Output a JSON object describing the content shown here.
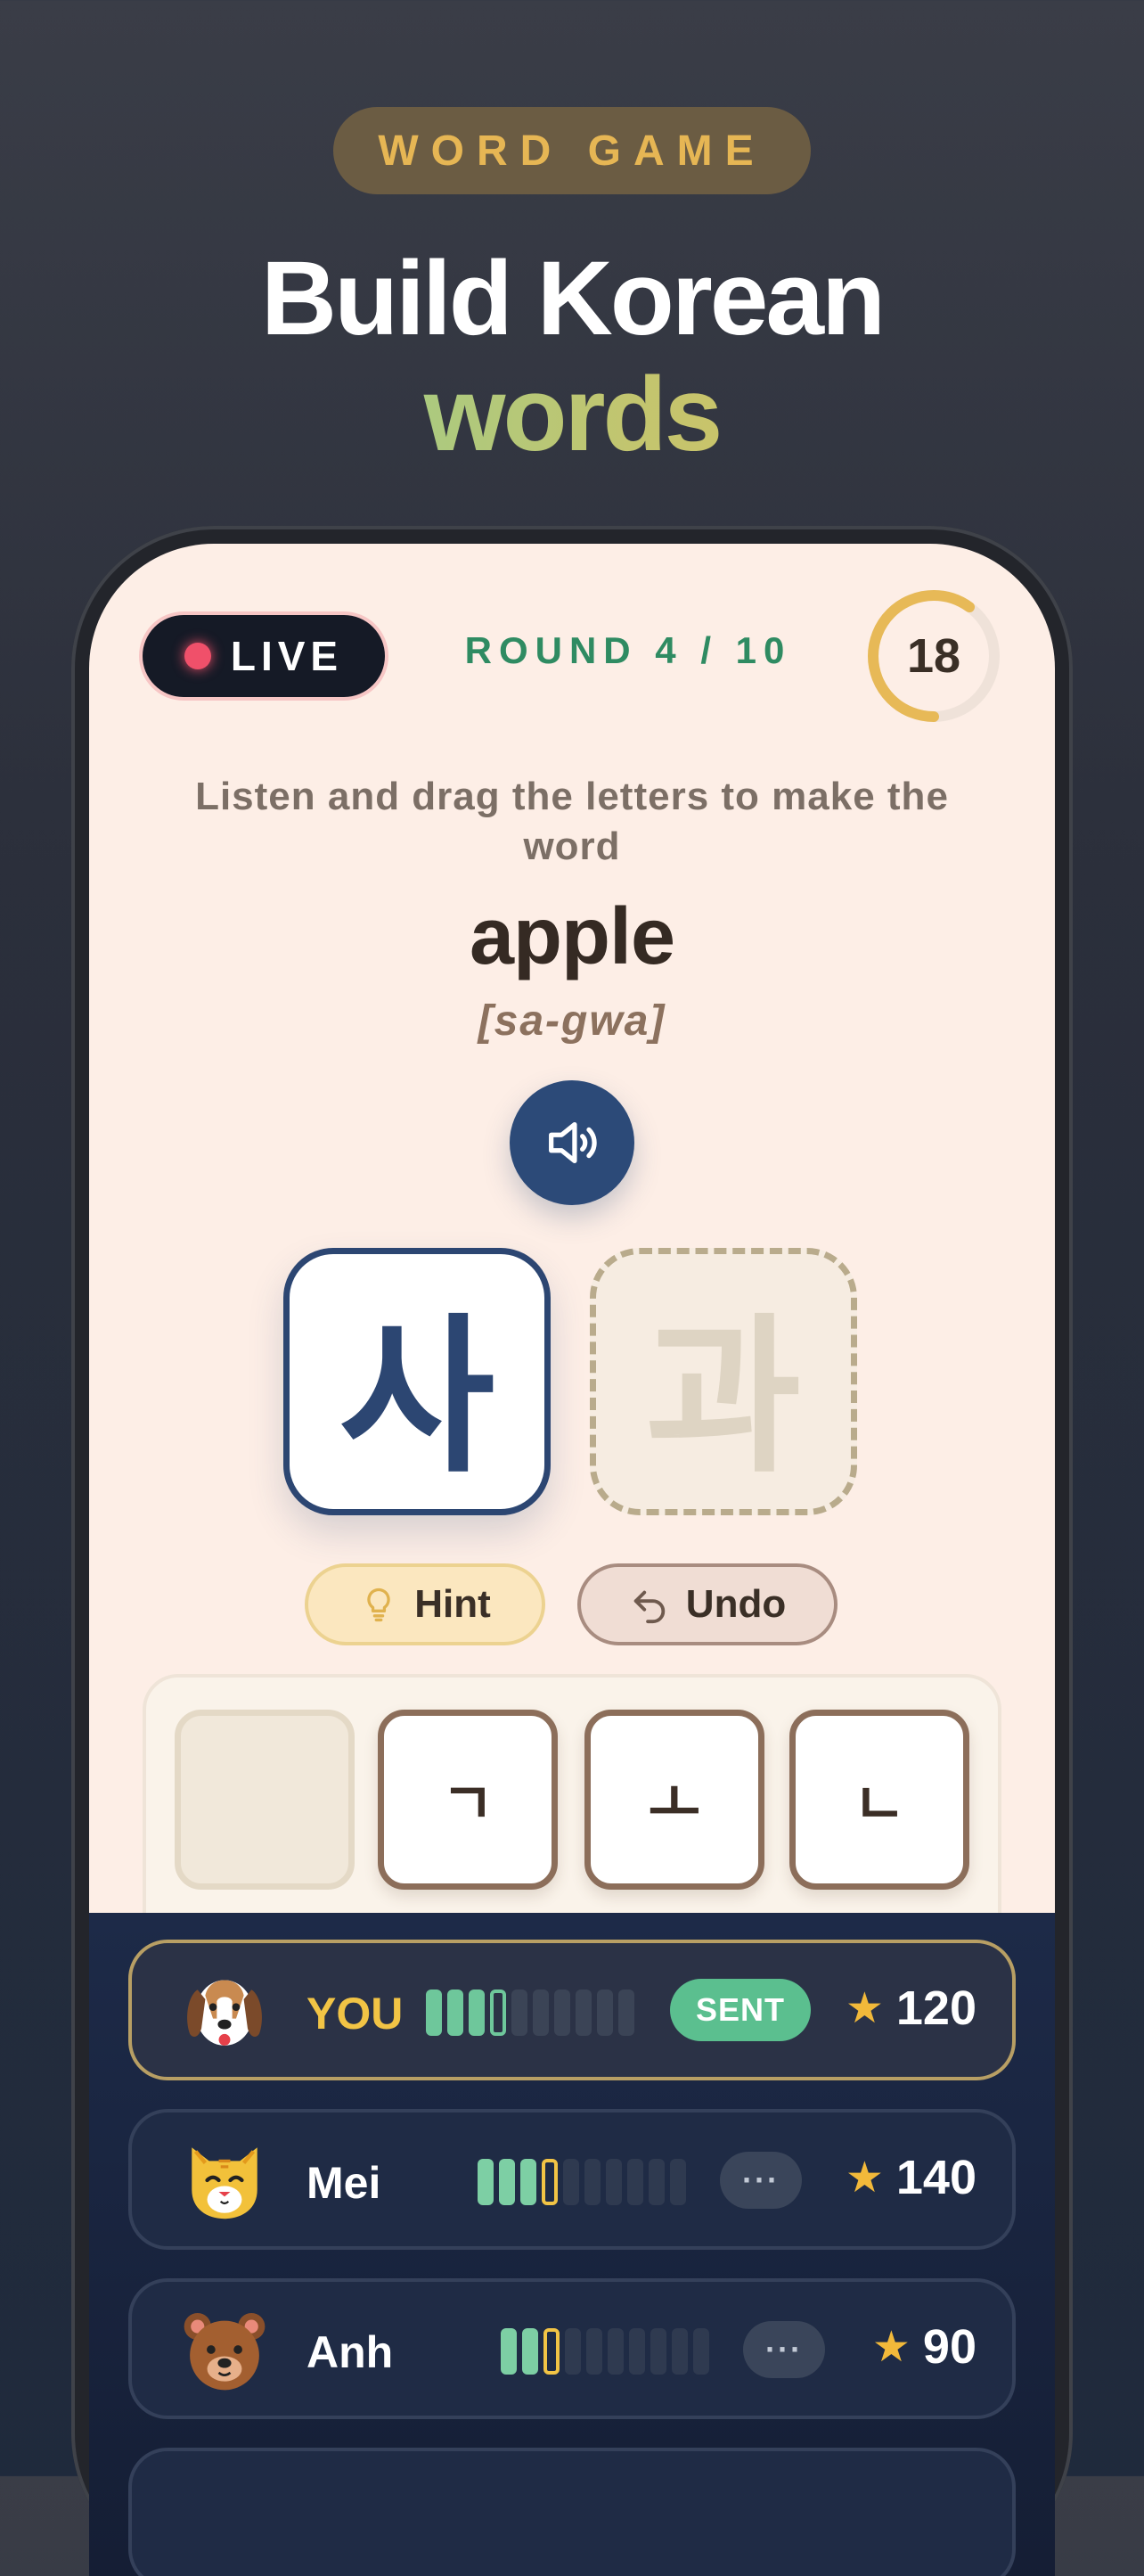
{
  "header": {
    "badge": "WORD GAME",
    "title_line1": "Build Korean",
    "title_line2": "words"
  },
  "game": {
    "live_label": "LIVE",
    "round_label": "ROUND 4 / 10",
    "timer_seconds": "18",
    "timer_fraction_remaining": 0.6,
    "instruction": "Listen and drag the letters to make the word",
    "word": "apple",
    "romanization": "[sa-gwa]",
    "audio_icon": "speaker-icon",
    "slots": [
      {
        "syllable": "사",
        "state": "filled"
      },
      {
        "syllable": "과",
        "state": "empty"
      }
    ],
    "hint_label": "Hint",
    "undo_label": "Undo",
    "tiles": [
      {
        "letter": "",
        "state": "used"
      },
      {
        "letter": "ㄱ",
        "state": "available"
      },
      {
        "letter": "ㅗ",
        "state": "available"
      },
      {
        "letter": "ㄴ",
        "state": "available"
      }
    ]
  },
  "players": [
    {
      "name": "YOU",
      "avatar": "dog-icon",
      "status": "SENT",
      "score": "120",
      "progress_done": 3,
      "progress_current": 4,
      "progress_total": 10
    },
    {
      "name": "Mei",
      "avatar": "cat-icon",
      "status": "···",
      "score": "140",
      "progress_done": 3,
      "progress_current": 4,
      "progress_total": 10
    },
    {
      "name": "Anh",
      "avatar": "bear-icon",
      "status": "···",
      "score": "90",
      "progress_done": 2,
      "progress_current": 3,
      "progress_total": 10
    }
  ],
  "colors": {
    "accent_gold": "#e6b654",
    "accent_green": "#2f8b62",
    "tile_blue": "#2c4672",
    "sent_green": "#5bbf8f",
    "live_red": "#f0506a"
  }
}
